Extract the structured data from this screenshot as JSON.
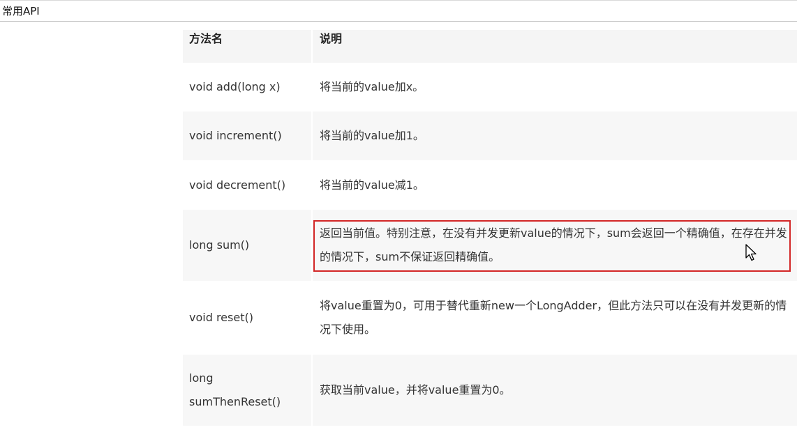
{
  "header": {
    "title": "常用API"
  },
  "table": {
    "columns": [
      "方法名",
      "说明"
    ],
    "rows": [
      {
        "method": "void add(long x)",
        "description": "将当前的value加x。"
      },
      {
        "method": "void increment()",
        "description": "将当前的value加1。"
      },
      {
        "method": "void decrement()",
        "description": "将当前的value减1。"
      },
      {
        "method": "long sum()",
        "description": "返回当前值。特别注意，在没有并发更新value的情况下，sum会返回一个精确值，在存在并发的情况下，sum不保证返回精确值。"
      },
      {
        "method": "void reset()",
        "description": "将value重置为0，可用于替代重新new一个LongAdder，但此方法只可以在没有并发更新的情况下使用。"
      },
      {
        "method": "long sumThenReset()",
        "description": "获取当前value，并将value重置为0。"
      }
    ]
  },
  "annotation": {
    "color": "#d32626"
  }
}
